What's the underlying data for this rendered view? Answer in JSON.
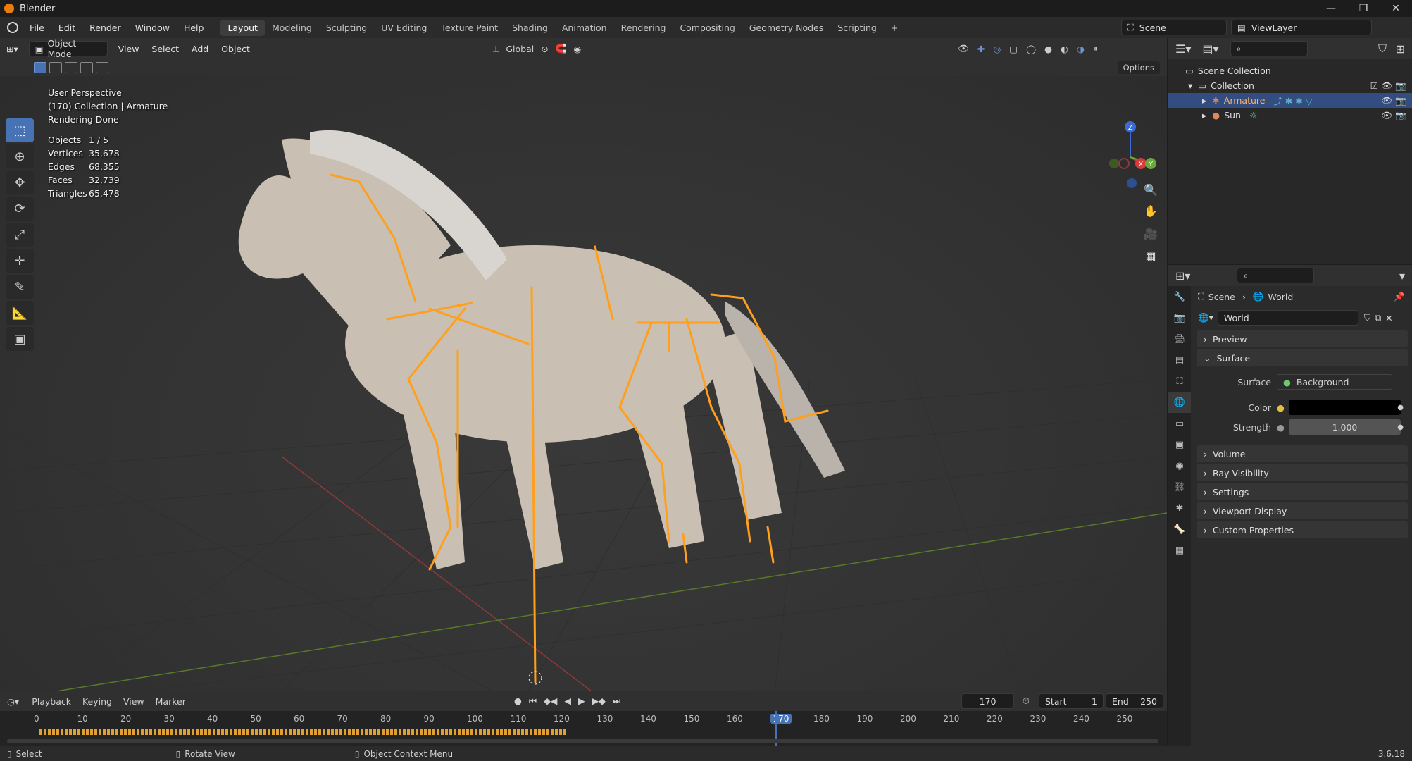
{
  "window": {
    "title": "Blender",
    "version": "3.6.18"
  },
  "menu": {
    "items": [
      "File",
      "Edit",
      "Render",
      "Window",
      "Help"
    ],
    "workspaces": [
      "Layout",
      "Modeling",
      "Sculpting",
      "UV Editing",
      "Texture Paint",
      "Shading",
      "Animation",
      "Rendering",
      "Compositing",
      "Geometry Nodes",
      "Scripting"
    ],
    "active_workspace": "Layout",
    "scene": "Scene",
    "view_layer": "ViewLayer"
  },
  "viewport": {
    "mode": "Object Mode",
    "menus": [
      "View",
      "Select",
      "Add",
      "Object"
    ],
    "orientation": "Global",
    "options_label": "Options",
    "info": {
      "line1": "User Perspective",
      "line2": "(170) Collection | Armature",
      "line3": "Rendering Done"
    },
    "stats": [
      {
        "label": "Objects",
        "value": "1 / 5"
      },
      {
        "label": "Vertices",
        "value": "35,678"
      },
      {
        "label": "Edges",
        "value": "68,355"
      },
      {
        "label": "Faces",
        "value": "32,739"
      },
      {
        "label": "Triangles",
        "value": "65,478"
      }
    ],
    "gizmo_axes": [
      "Z",
      "X",
      "Y"
    ]
  },
  "timeline": {
    "menus": [
      "Playback",
      "Keying",
      "View",
      "Marker"
    ],
    "current_frame": "170",
    "start_label": "Start",
    "start": "1",
    "end_label": "End",
    "end": "250",
    "ticks": [
      "0",
      "10",
      "20",
      "30",
      "40",
      "50",
      "60",
      "70",
      "80",
      "90",
      "100",
      "110",
      "120",
      "130",
      "140",
      "150",
      "160",
      "170",
      "180",
      "190",
      "200",
      "210",
      "220",
      "230",
      "240",
      "250"
    ]
  },
  "status": {
    "select": "Select",
    "rotate": "Rotate View",
    "context": "Object Context Menu"
  },
  "outliner": {
    "scene_collection": "Scene Collection",
    "collection": "Collection",
    "objects": [
      {
        "name": "Armature",
        "selected": true
      },
      {
        "name": "Sun",
        "selected": false
      }
    ]
  },
  "properties": {
    "breadcrumb_scene": "Scene",
    "breadcrumb_world": "World",
    "world_name": "World",
    "panels": {
      "preview": "Preview",
      "surface": "Surface",
      "volume": "Volume",
      "ray_visibility": "Ray Visibility",
      "settings": "Settings",
      "viewport_display": "Viewport Display",
      "custom_properties": "Custom Properties"
    },
    "surface_label": "Surface",
    "surface_value": "Background",
    "color_label": "Color",
    "color_value": "#000000",
    "strength_label": "Strength",
    "strength_value": "1.000"
  },
  "colors": {
    "accent": "#4772b3",
    "bone": "#ff9f1c",
    "active_tab": "#e0875b"
  }
}
